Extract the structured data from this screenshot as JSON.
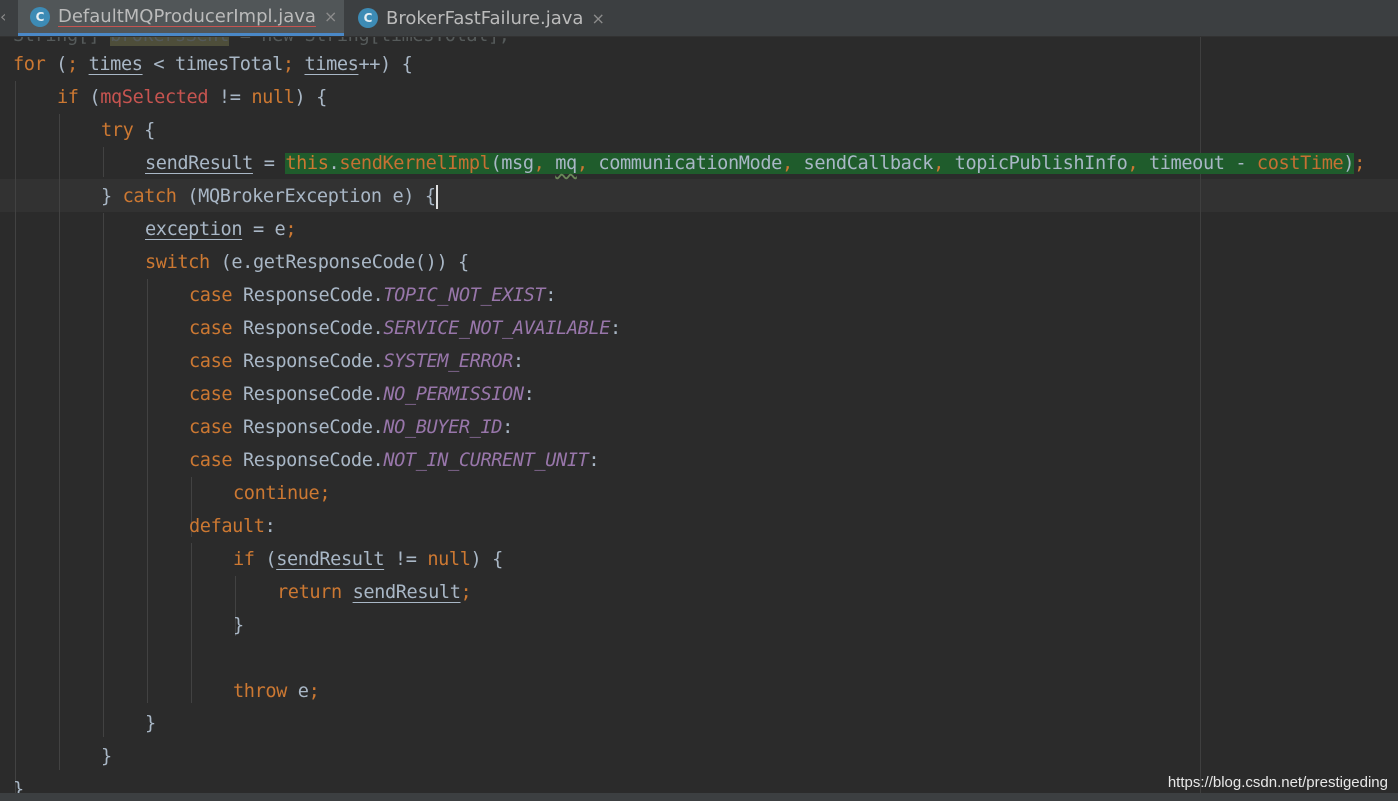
{
  "tabs": [
    {
      "label": "DefaultMQProducerImpl.java",
      "icon": "class-icon",
      "icon_glyph": "C",
      "active": true,
      "close": "×"
    },
    {
      "label": "BrokerFastFailure.java",
      "icon": "class-icon",
      "icon_glyph": "C",
      "active": false,
      "close": "×"
    }
  ],
  "scroll_left_glyph": "‹",
  "code": {
    "line0": {
      "a": "String[] ",
      "b": "brokersSent",
      "c": " = new String[timesTotal];"
    },
    "line1": {
      "kw": "for",
      "a": " (",
      "p1": ";",
      "b": " ",
      "v1": "times",
      "c": " < timesTotal",
      "p2": ";",
      "d": " ",
      "v2": "times",
      "e": "++) {"
    },
    "line2": {
      "kw": "if",
      "a": " (",
      "f": "mqSelected",
      "b": " != ",
      "kw2": "null",
      "c": ") {"
    },
    "line3": {
      "kw": "try",
      "a": " {"
    },
    "line4": {
      "v": "sendResult",
      "a": " = ",
      "kw": "this",
      "dot": ".",
      "m": "sendKernelImpl",
      "b": "(msg",
      "c1": ",",
      "s1": " ",
      "mq": "mq",
      "c2": ",",
      "r1": " communicationMode",
      "c3": ",",
      "r2": " sendCallback",
      "c4": ",",
      "r3": " topicPublishInfo",
      "c5": ",",
      "r4": " timeout - ",
      "ct": "costTime",
      "end": ")",
      "semi": ";"
    },
    "line5": {
      "a": "} ",
      "kw": "catch",
      "b": " (MQBrokerException e) {"
    },
    "line6": {
      "v": "exception",
      "a": " = e",
      "semi": ";"
    },
    "line7": {
      "kw": "switch",
      "a": " (e.getResponseCode()) {"
    },
    "cases": [
      {
        "kw": "case",
        "cls": " ResponseCode.",
        "cst": "TOPIC_NOT_EXIST",
        "colon": ":"
      },
      {
        "kw": "case",
        "cls": " ResponseCode.",
        "cst": "SERVICE_NOT_AVAILABLE",
        "colon": ":"
      },
      {
        "kw": "case",
        "cls": " ResponseCode.",
        "cst": "SYSTEM_ERROR",
        "colon": ":"
      },
      {
        "kw": "case",
        "cls": " ResponseCode.",
        "cst": "NO_PERMISSION",
        "colon": ":"
      },
      {
        "kw": "case",
        "cls": " ResponseCode.",
        "cst": "NO_BUYER_ID",
        "colon": ":"
      },
      {
        "kw": "case",
        "cls": " ResponseCode.",
        "cst": "NOT_IN_CURRENT_UNIT",
        "colon": ":"
      }
    ],
    "line14": {
      "kw": "continue",
      "semi": ";"
    },
    "line15": {
      "kw": "default",
      "a": ":"
    },
    "line16": {
      "kw": "if",
      "a": " (",
      "v": "sendResult",
      "b": " != ",
      "kw2": "null",
      "c": ") {"
    },
    "line17": {
      "kw": "return",
      "a": " ",
      "v": "sendResult",
      "semi": ";"
    },
    "line18": {
      "a": "}"
    },
    "line20": {
      "kw": "throw",
      "a": " e",
      "semi": ";"
    },
    "line21": {
      "a": "}"
    },
    "line22": {
      "a": "}"
    },
    "line23": {
      "a": "}"
    }
  },
  "watermark": "https://blog.csdn.net/prestigeding",
  "colors": {
    "background": "#2b2b2b",
    "keyword": "#cc7832",
    "field": "#9876aa",
    "default_text": "#a9b7c6",
    "highlight": "#1f5c2c",
    "tab_underline": "#4a88c7"
  }
}
